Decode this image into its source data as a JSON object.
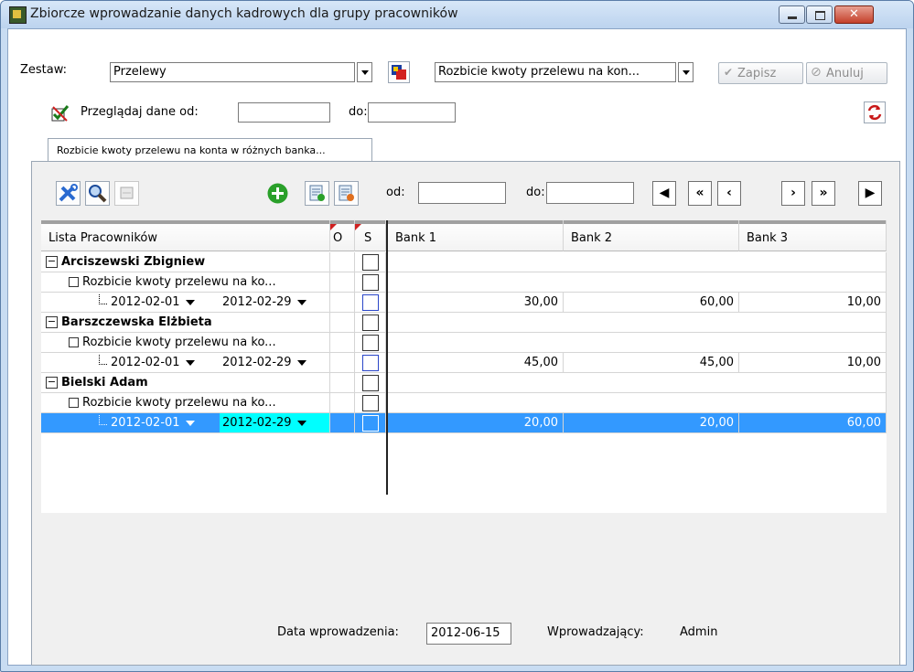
{
  "window": {
    "title": "Zbiorcze wprowadzanie danych kadrowych dla grupy pracowników",
    "close_label": "✕"
  },
  "toolbar": {
    "zestaw_label": "Zestaw:",
    "zestaw_value": "Przelewy",
    "definition_value": "Rozbicie kwoty przelewu na kon...",
    "save_label": "Zapisz",
    "cancel_label": "Anuluj",
    "browse_label": "Przeglądaj dane od:",
    "to_label": "do:",
    "browse_from": "",
    "browse_to": ""
  },
  "tab": {
    "label": "Rozbicie kwoty przelewu na konta w różnych banka..."
  },
  "panel": {
    "from_label": "od:",
    "to_label": "do:",
    "from_value": "",
    "to_value": "",
    "nav": [
      "◀",
      "«",
      "‹",
      "›",
      "»",
      "▶"
    ]
  },
  "grid": {
    "headers": {
      "employees": "Lista Pracowników",
      "o": "O",
      "s": "S",
      "bank1": "Bank 1",
      "bank2": "Bank 2",
      "bank3": "Bank 3"
    },
    "employees": [
      {
        "name": "Arciszewski Zbigniew",
        "subrow": "Rozbicie kwoty przelewu na ko...",
        "date_from": "2012-02-01",
        "date_to": "2012-02-29",
        "bank1": "30,00",
        "bank2": "60,00",
        "bank3": "10,00"
      },
      {
        "name": "Barszczewska Elżbieta",
        "subrow": "Rozbicie kwoty przelewu na ko...",
        "date_from": "2012-02-01",
        "date_to": "2012-02-29",
        "bank1": "45,00",
        "bank2": "45,00",
        "bank3": "10,00"
      },
      {
        "name": "Bielski Adam",
        "subrow": "Rozbicie kwoty przelewu na ko...",
        "date_from": "2012-02-01",
        "date_to": "2012-02-29",
        "bank1": "20,00",
        "bank2": "20,00",
        "bank3": "60,00"
      }
    ]
  },
  "footer": {
    "entry_date_label": "Data wprowadzenia:",
    "entry_date_value": "2012-06-15",
    "entered_by_label": "Wprowadzający:",
    "entered_by_value": "Admin"
  },
  "colors": {
    "selection": "#3399ff",
    "date_highlight": "#00ffff",
    "window_frame": "#c8dcf2"
  }
}
